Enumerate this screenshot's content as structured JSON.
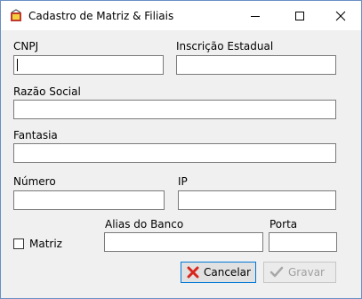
{
  "window": {
    "title": "Cadastro de Matriz & Filiais"
  },
  "fields": {
    "cnpj": {
      "label": "CNPJ",
      "value": ""
    },
    "inscricao_estadual": {
      "label": "Inscrição Estadual",
      "value": ""
    },
    "razao_social": {
      "label": "Razão Social",
      "value": ""
    },
    "fantasia": {
      "label": "Fantasia",
      "value": ""
    },
    "numero": {
      "label": "Número",
      "value": ""
    },
    "ip": {
      "label": "IP",
      "value": ""
    },
    "alias_banco": {
      "label": "Alias do Banco",
      "value": ""
    },
    "porta": {
      "label": "Porta",
      "value": ""
    }
  },
  "matriz": {
    "label": "Matriz",
    "checked": false
  },
  "buttons": {
    "cancel": "Cancelar",
    "save": "Gravar"
  },
  "icons": {
    "app": "app-icon",
    "minimize": "minimize-icon",
    "maximize": "maximize-icon",
    "close": "close-icon",
    "cancel": "x-icon",
    "save": "check-icon"
  },
  "colors": {
    "cancel_icon": "#d9261c",
    "focus_border": "#0078d7",
    "disabled_text": "#a0a0a0"
  }
}
